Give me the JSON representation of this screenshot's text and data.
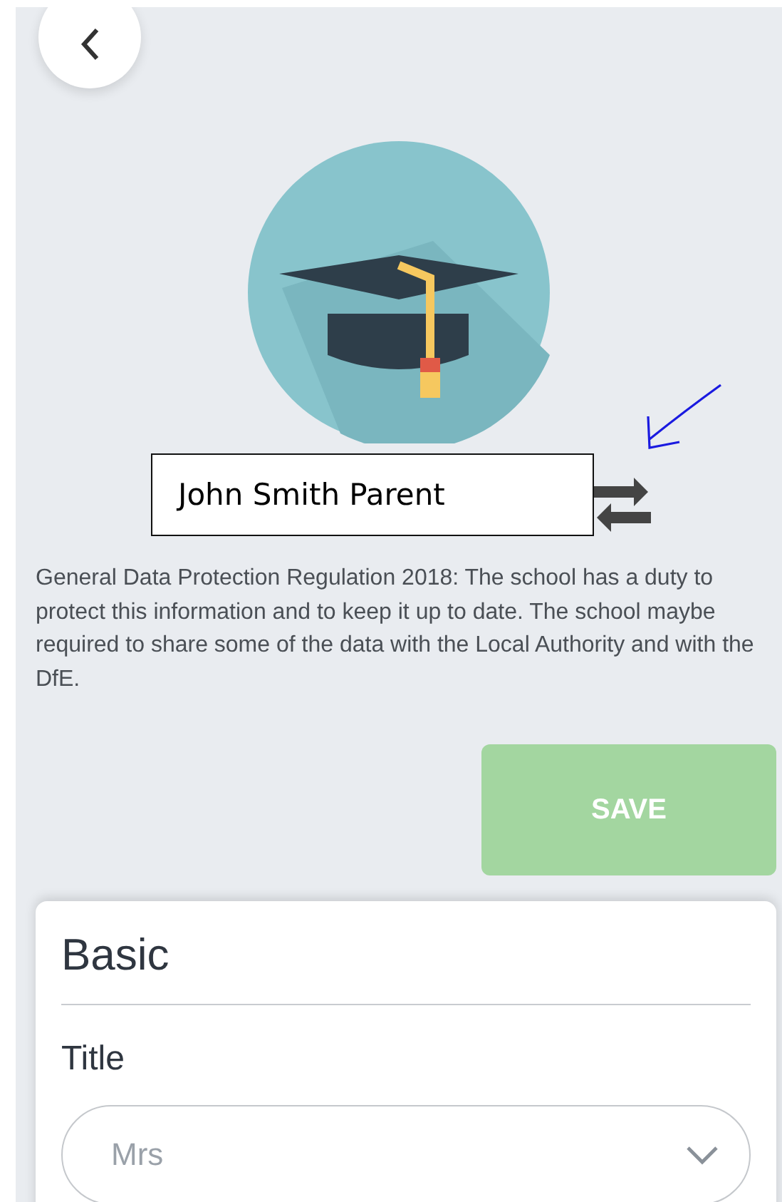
{
  "profile": {
    "name_label": "John Smith Parent"
  },
  "notice": "General Data Protection Regulation 2018: The school has a duty to protect this information and to keep it up to date. The school maybe required to share some of the data with the Local Authority and with the DfE.",
  "save_button": {
    "label": "SAVE",
    "disabled": true
  },
  "card": {
    "title": "Basic",
    "fields": [
      {
        "kind": "select",
        "label": "Title",
        "value": "Mrs"
      }
    ]
  }
}
